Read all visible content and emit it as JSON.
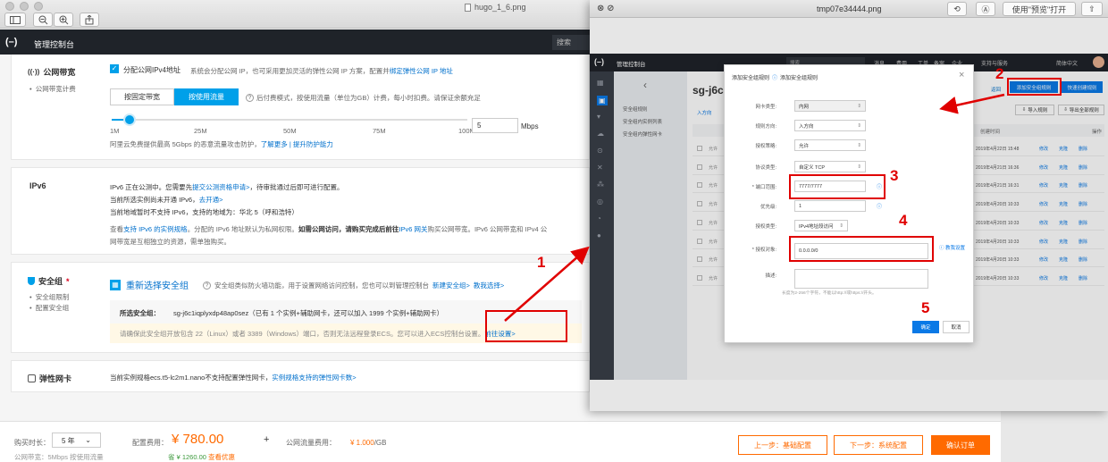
{
  "back_window": {
    "file_title": "hugo_1_6.png",
    "console": {
      "title": "管理控制台",
      "search": "搜索"
    },
    "bandwidth": {
      "title": "公网带宽",
      "bullet": "公网带宽计费",
      "checkbox_label": "分配公网IPv4地址",
      "desc": "系统会分配公网 IP，也可采用更加灵活的弹性公网 IP 方案，配置并",
      "desc_link": "绑定弹性公网 IP 地址",
      "btn_fixed": "按固定带宽",
      "btn_traffic": "按使用流量",
      "traffic_note": "后付费模式，按使用流量（单位为GB）计费，每小时扣费。请保证余额充足",
      "ticks": [
        "1M",
        "25M",
        "50M",
        "75M",
        "100M"
      ],
      "value": "5",
      "unit": "Mbps",
      "level": 0.05,
      "protect_text": "阿里云免费提供最高 5Gbps 的恶意流量攻击防护，",
      "protect_link": "了解更多 | 提升防护能力"
    },
    "ipv6": {
      "title": "IPv6",
      "line1_pre": "IPv6 正在公测中。您需要先",
      "line1_link": "提交公测资格申请>",
      "line1_post": "，待审批通过后即可进行配置。",
      "line2_pre": "当前所选实例尚未开通 IPv6，",
      "line2_link": "去开通>",
      "line3": "当前地域暂时不支持 IPv6，支持的地域为：华北 5（呼和浩特）",
      "line4_pre": "查看",
      "line4_link1": "支持 IPv6 的实例规格",
      "line4_mid": "。分配的 IPv6 地址默认为私网权限。",
      "line4_bold": "如需公网访问，请购买完成后前往",
      "line4_link2": "IPv6 网关",
      "line4_post": "购买公网带宽。IPv6 公网带宽和 IPv4 公",
      "line5": "网带宽是互相独立的资源，需单独购买。"
    },
    "security": {
      "title": "安全组",
      "required": "*",
      "bullets": [
        "安全组限制",
        "配置安全组"
      ],
      "reselect": "重新选择安全组",
      "desc": "安全组类似防火墙功能，用于设置网络访问控制，您也可以到管理控制台",
      "link_new": "新建安全组>",
      "link_guide": "教我选择>",
      "selected_label": "所选安全组：",
      "selected_value": "sg-j6c1iqplyxdp48ap0sez（已有 1 个实例+辅助网卡，还可以加入 1999 个实例+辅助网卡）",
      "warn": "请确保此安全组开放包含 22（Linux）或者 3389（Windows）端口，否则无法远程登录ECS。您可以进入ECS控制台设置。",
      "warn_link": "前往设置>"
    },
    "eni": {
      "title": "弹性网卡",
      "text": "当前实例规格ecs.t5-lc2m1.nano不支持配置弹性网卡，",
      "link": "实例规格支持的弹性网卡数>"
    },
    "footer": {
      "duration_label": "购买时长：",
      "duration_value": "5 年",
      "fee_label": "配置费用：",
      "fee_value": "¥ 780.00",
      "plus": "+",
      "traffic_label": "公网流量费用：",
      "traffic_value": "¥ 1.000",
      "traffic_unit": "/GB",
      "bw_note": "公网带宽：5Mbps 按使用流量",
      "save": "省 ¥ 1260.00",
      "save_link": "查看优惠",
      "prev": "上一步：基础配置",
      "next": "下一步：系统配置",
      "confirm": "确认订单"
    }
  },
  "front_window": {
    "file_title": "tmp07e34444.png",
    "open_with": "使用\"预览\"打开",
    "console": {
      "title": "管理控制台",
      "search": "搜索",
      "nav": [
        "消息",
        "费用",
        "工单",
        "备案",
        "企业",
        "支持与服务"
      ],
      "lang": "简体中文"
    },
    "sg_title": "sg-j6c1",
    "side_menu": [
      "安全组规则",
      "安全组内实例列表",
      "安全组内弹性网卡"
    ],
    "back_link": "返回",
    "add_rule_btn": "添加安全组规则",
    "quick_btn": "快速创建规则",
    "tab_in": "入方向",
    "import_btn": "导入规则",
    "export_btn": "导出全部规则",
    "col_time": "创建时间",
    "col_op": "操作",
    "rows": [
      {
        "allow": "允许",
        "time": "2019年4月22日 15:48"
      },
      {
        "allow": "允许",
        "time": "2019年4月21日 16:36"
      },
      {
        "allow": "允许",
        "time": "2019年4月21日 16:31"
      },
      {
        "allow": "允许",
        "time": "2019年4月20日 10:33"
      },
      {
        "allow": "允许",
        "time": "2019年4月20日 10:33"
      },
      {
        "allow": "允许",
        "time": "2019年4月20日 10:33"
      },
      {
        "allow": "允许",
        "time": "2019年4月20日 10:33"
      },
      {
        "allow": "允许",
        "time": "2019年4月20日 10:33"
      }
    ],
    "row_ops": [
      "修改",
      "克隆",
      "删除"
    ],
    "dialog": {
      "title": "添加安全组规则",
      "help": "添加安全组规则",
      "fields": [
        {
          "label": "网卡类型:",
          "value": "内网"
        },
        {
          "label": "规则方向:",
          "value": "入方向"
        },
        {
          "label": "授权策略:",
          "value": "允许"
        },
        {
          "label": "协议类型:",
          "value": "自定义 TCP"
        },
        {
          "label": "* 端口范围:",
          "value": "7777/7777"
        },
        {
          "label": "优先级:",
          "value": "1"
        },
        {
          "label": "授权类型:",
          "value": "IPv4地址段访问"
        },
        {
          "label": "* 授权对象:",
          "value": "0.0.0.0/0"
        },
        {
          "label": "描述:",
          "value": ""
        }
      ],
      "teach": "教我设置",
      "desc_hint": "长度为2-256个字符，不能以http://或https://开头。",
      "ok": "确定",
      "cancel": "取消"
    }
  },
  "annotations": [
    "1",
    "2",
    "3",
    "4",
    "5"
  ],
  "colors": {
    "accent": "#00a0e9",
    "orange": "#ff6a00",
    "annotation": "#e00000",
    "console_bar": "#1f2329"
  }
}
